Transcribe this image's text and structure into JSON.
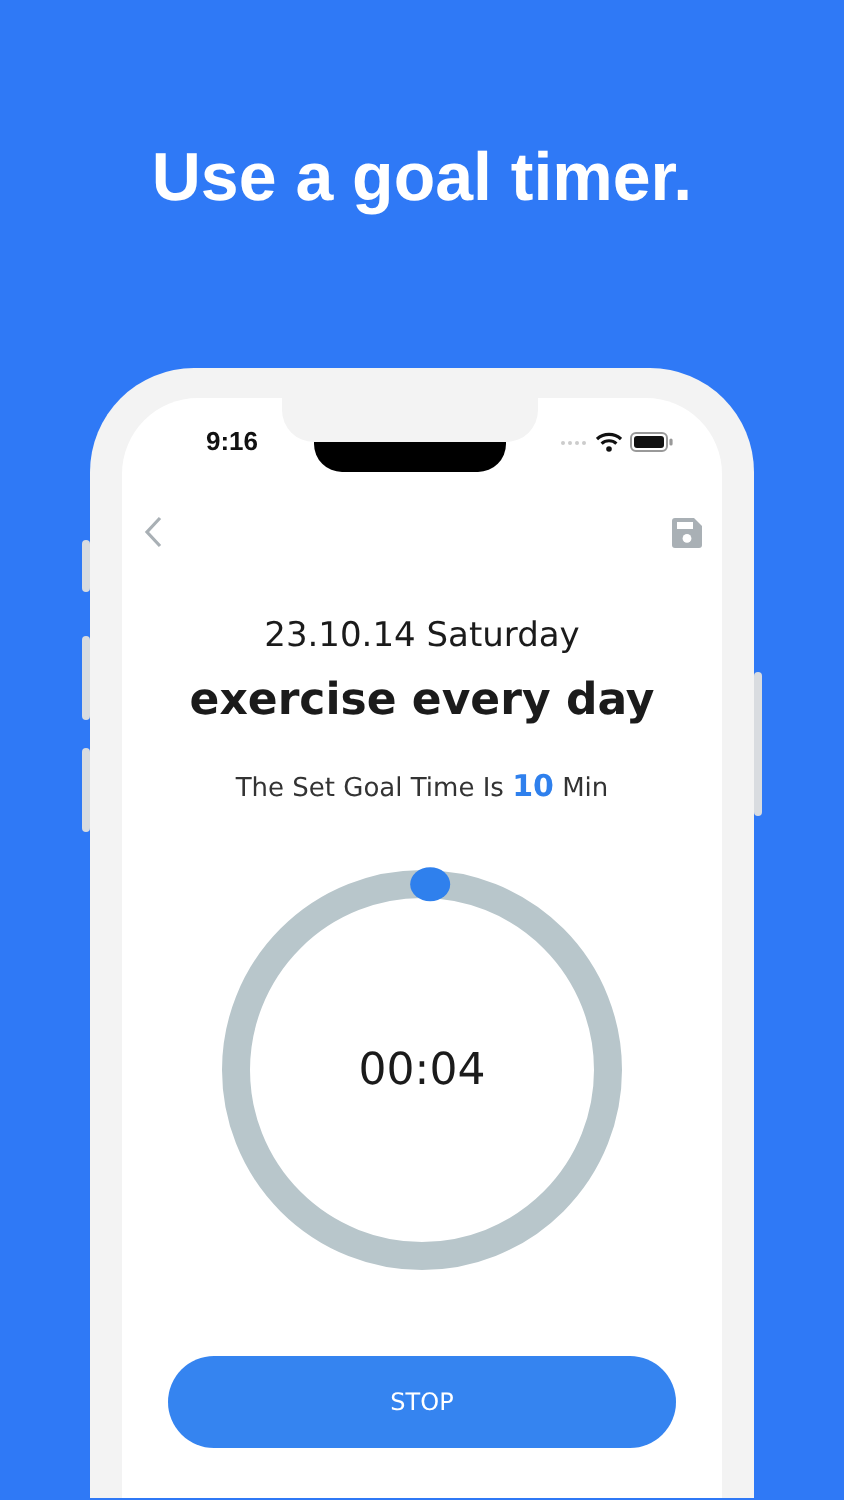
{
  "headline": "Use a goal timer.",
  "status_bar": {
    "time": "9:16"
  },
  "screen": {
    "date": "23.10.14 Saturday",
    "title": "exercise every day",
    "goal_text": "The Set Goal Time Is **10** Min",
    "timer": {
      "time": "00:04",
      "level": 0.007
    },
    "button": "STOP"
  }
}
